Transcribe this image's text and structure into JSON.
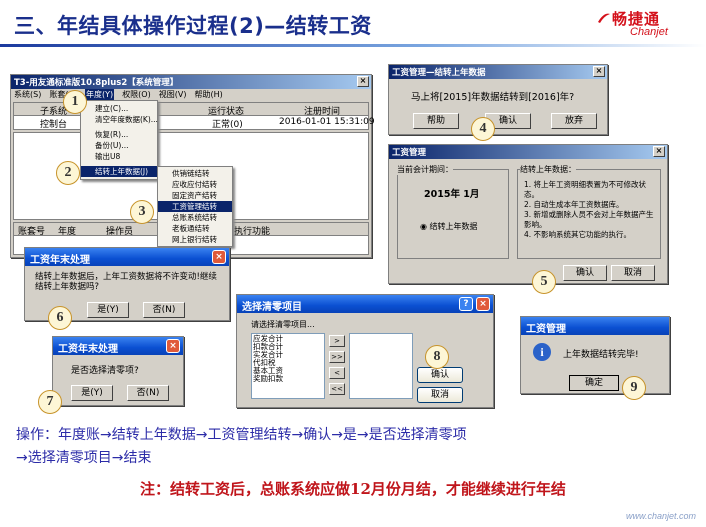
{
  "title": "三、年结具体操作过程(2)—结转工资",
  "logo": {
    "cn": "畅捷通",
    "en": "Chanjet"
  },
  "main_window": {
    "title": "T3-用友通标准版10.8plus2【系统管理】",
    "menus": [
      "系统(S)",
      "账套(A)",
      "年度(Y)",
      "权限(O)",
      "视图(V)",
      "帮助(H)"
    ],
    "headers": [
      "子系统",
      "运行状态",
      "注册时间"
    ],
    "row": [
      "控制台",
      "正常(0)",
      "2016-01-01 15:31:09"
    ],
    "bottom_headers": [
      "账套号",
      "年度",
      "操作员",
      "执行功能"
    ]
  },
  "year_menu": {
    "items": [
      "建立(C)...",
      "清空年度数据(K)...",
      "恢复(R)...",
      "备份(U)...",
      "输出U8",
      "结转上年数据(J)"
    ]
  },
  "sub_menu": {
    "items": [
      "供销链结转",
      "应收应付结转",
      "固定资产结转",
      "工资管理结转",
      "总账系统结转",
      "老板通结转",
      "网上银行结转"
    ]
  },
  "confirm_dialog": {
    "title": "工资管理—结转上年数据",
    "message": "马上将[2015]年数据结转到[2016]年?",
    "buttons": [
      "帮助",
      "确认",
      "放弃"
    ]
  },
  "period_dialog": {
    "title": "工资管理",
    "current_label": "当前会计期间：",
    "period": "2015年   1月",
    "radio_label": "结转上年数据",
    "info_title": "结转上年数据：",
    "info": [
      "1. 将上年工资明细表置为不可修改状态。",
      "2. 自动生成本年工资数据库。",
      "3. 新增或删除人员不会对上年数据产生影响。",
      "4. 不影响系统其它功能的执行。"
    ],
    "buttons": [
      "确认",
      "取消"
    ]
  },
  "yearend_dialog_1": {
    "title": "工资年末处理",
    "message": "结转上年数据后，上年工资数据将不许变动!继续结转上年数据吗?",
    "buttons": [
      "是(Y)",
      "否(N)"
    ]
  },
  "yearend_dialog_2": {
    "title": "工资年末处理",
    "message": "是否选择清零项?",
    "buttons": [
      "是(Y)",
      "否(N)"
    ]
  },
  "clear_dialog": {
    "title": "选择清零项目",
    "label": "请选择清零项目...",
    "items": [
      "应发合计",
      "扣款合计",
      "实发合计",
      "代扣税",
      "基本工资",
      "奖励扣款"
    ],
    "arrows": [
      ">",
      ">>",
      "<",
      "<<"
    ],
    "buttons": [
      "确认",
      "取消"
    ]
  },
  "done_dialog": {
    "title": "工资管理",
    "message": "上年数据结转完毕!",
    "button": "确定"
  },
  "steps": [
    "1",
    "2",
    "3",
    "4",
    "5",
    "6",
    "7",
    "8",
    "9"
  ],
  "operation_line1": "操作：年度账→结转上年数据→工资管理结转→确认→是→是否选择清零项",
  "operation_line2": "→选择清零项目→结束",
  "note": "注：结转工资后，总账系统应做12月份月结，才能继续进行年结",
  "footer": "www.chanjet.com"
}
